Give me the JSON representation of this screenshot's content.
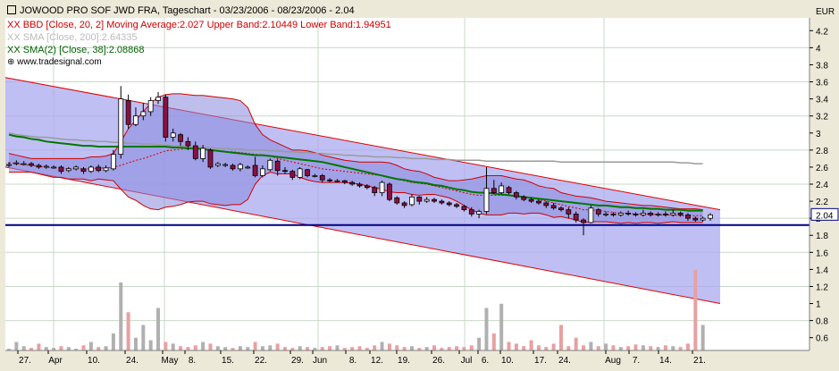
{
  "chart_data": {
    "type": "candlestick",
    "title": "JOWOOD PRO SOF JWD FRA, Tageschart - 03/23/2006 - 08/23/2006 - 2.04",
    "legend": [
      {
        "text": "XX BBD [Close, 20, 2] Moving Average:2.027 Upper Band:2.10449 Lower Band:1.94951",
        "color": "#cc0000"
      },
      {
        "text": "XX SMA [Close, 200]:2.64335",
        "color": "#bbbbbb"
      },
      {
        "text": "XX SMA(2) [Close, 38]:2.08868",
        "color": "#006400"
      }
    ],
    "watermark": "www.tradesignal.com",
    "y_axis_unit": "EUR",
    "y_ticks": [
      "4.2",
      "4",
      "3.8",
      "3.6",
      "3.4",
      "3.2",
      "3",
      "2.8",
      "2.6",
      "2.4",
      "2.2",
      "2",
      "1.8",
      "1.6",
      "1.4",
      "1.2",
      "1",
      "0.8",
      "0.6"
    ],
    "last_price_label": "2.04",
    "y_range": [
      0.45,
      4.35
    ],
    "x_labels": [
      "27.",
      "Apr",
      "10.",
      "24.",
      "May",
      "8.",
      "15.",
      "22.",
      "29.",
      "Jun",
      "8.",
      "12.",
      "19.",
      "26.",
      "Jul",
      "6.",
      "10.",
      "17.",
      "24.",
      "Aug",
      "7.",
      "14.",
      "21."
    ],
    "horizontal_line": 1.92,
    "channel": {
      "upper": [
        3.65,
        2.1
      ],
      "lower": [
        2.6,
        1.0
      ]
    },
    "candles": [
      [
        2.62,
        2.63,
        2.66,
        2.6
      ],
      [
        2.64,
        2.65,
        2.68,
        2.62
      ],
      [
        2.64,
        2.64,
        2.67,
        2.62
      ],
      [
        2.64,
        2.62,
        2.66,
        2.6
      ],
      [
        2.62,
        2.6,
        2.64,
        2.58
      ],
      [
        2.6,
        2.61,
        2.63,
        2.58
      ],
      [
        2.6,
        2.6,
        2.62,
        2.58
      ],
      [
        2.6,
        2.55,
        2.62,
        2.52
      ],
      [
        2.56,
        2.58,
        2.6,
        2.54
      ],
      [
        2.58,
        2.6,
        2.62,
        2.56
      ],
      [
        2.58,
        2.55,
        2.6,
        2.52
      ],
      [
        2.55,
        2.6,
        2.62,
        2.53
      ],
      [
        2.6,
        2.56,
        2.63,
        2.54
      ],
      [
        2.56,
        2.59,
        2.62,
        2.54
      ],
      [
        2.58,
        2.75,
        2.8,
        2.56
      ],
      [
        2.75,
        3.4,
        3.55,
        2.7
      ],
      [
        3.38,
        3.1,
        3.45,
        3.05
      ],
      [
        3.1,
        3.2,
        3.3,
        3.08
      ],
      [
        3.2,
        3.25,
        3.35,
        3.15
      ],
      [
        3.25,
        3.38,
        3.42,
        3.2
      ],
      [
        3.38,
        3.42,
        3.48,
        3.34
      ],
      [
        3.42,
        2.95,
        3.45,
        2.9
      ],
      [
        2.95,
        3.0,
        3.05,
        2.9
      ],
      [
        2.98,
        2.9,
        3.0,
        2.85
      ],
      [
        2.9,
        2.85,
        2.95,
        2.8
      ],
      [
        2.85,
        2.7,
        2.9,
        2.68
      ],
      [
        2.7,
        2.82,
        2.86,
        2.66
      ],
      [
        2.8,
        2.6,
        2.82,
        2.58
      ],
      [
        2.62,
        2.64,
        2.66,
        2.6
      ],
      [
        2.63,
        2.63,
        2.65,
        2.6
      ],
      [
        2.62,
        2.58,
        2.64,
        2.56
      ],
      [
        2.58,
        2.63,
        2.65,
        2.55
      ],
      [
        2.6,
        2.6,
        2.62,
        2.58
      ],
      [
        2.62,
        2.5,
        2.72,
        2.48
      ],
      [
        2.5,
        2.58,
        2.62,
        2.48
      ],
      [
        2.57,
        2.68,
        2.7,
        2.55
      ],
      [
        2.67,
        2.56,
        2.69,
        2.5
      ],
      [
        2.56,
        2.55,
        2.6,
        2.52
      ],
      [
        2.55,
        2.48,
        2.57,
        2.45
      ],
      [
        2.48,
        2.58,
        2.6,
        2.46
      ],
      [
        2.57,
        2.5,
        2.58,
        2.48
      ],
      [
        2.5,
        2.5,
        2.52,
        2.48
      ],
      [
        2.5,
        2.45,
        2.52,
        2.42
      ],
      [
        2.45,
        2.44,
        2.47,
        2.42
      ],
      [
        2.44,
        2.44,
        2.46,
        2.42
      ],
      [
        2.44,
        2.42,
        2.45,
        2.4
      ],
      [
        2.42,
        2.4,
        2.44,
        2.38
      ],
      [
        2.4,
        2.38,
        2.42,
        2.36
      ],
      [
        2.38,
        2.36,
        2.4,
        2.34
      ],
      [
        2.36,
        2.3,
        2.38,
        2.26
      ],
      [
        2.3,
        2.42,
        2.44,
        2.26
      ],
      [
        2.4,
        2.22,
        2.42,
        2.2
      ],
      [
        2.24,
        2.18,
        2.26,
        2.16
      ],
      [
        2.18,
        2.15,
        2.2,
        2.12
      ],
      [
        2.16,
        2.25,
        2.28,
        2.14
      ],
      [
        2.25,
        2.2,
        2.26,
        2.16
      ],
      [
        2.2,
        2.22,
        2.25,
        2.18
      ],
      [
        2.22,
        2.2,
        2.24,
        2.18
      ],
      [
        2.2,
        2.18,
        2.22,
        2.16
      ],
      [
        2.18,
        2.16,
        2.2,
        2.14
      ],
      [
        2.16,
        2.14,
        2.18,
        2.12
      ],
      [
        2.14,
        2.1,
        2.16,
        2.08
      ],
      [
        2.1,
        2.05,
        2.13,
        2.02
      ],
      [
        2.05,
        2.08,
        2.1,
        2.0
      ],
      [
        2.08,
        2.35,
        2.6,
        2.05
      ],
      [
        2.35,
        2.3,
        2.45,
        2.28
      ],
      [
        2.3,
        2.38,
        2.42,
        2.28
      ],
      [
        2.36,
        2.3,
        2.38,
        2.28
      ],
      [
        2.3,
        2.25,
        2.32,
        2.22
      ],
      [
        2.25,
        2.22,
        2.27,
        2.2
      ],
      [
        2.22,
        2.2,
        2.24,
        2.18
      ],
      [
        2.2,
        2.18,
        2.22,
        2.16
      ],
      [
        2.18,
        2.15,
        2.2,
        2.12
      ],
      [
        2.15,
        2.12,
        2.18,
        2.1
      ],
      [
        2.12,
        2.1,
        2.14,
        2.08
      ],
      [
        2.1,
        2.05,
        2.13,
        2.0
      ],
      [
        2.05,
        1.98,
        2.08,
        1.95
      ],
      [
        1.98,
        1.95,
        2.0,
        1.8
      ],
      [
        1.95,
        2.12,
        2.15,
        1.94
      ],
      [
        2.1,
        2.05,
        2.12,
        2.02
      ],
      [
        2.05,
        2.05,
        2.08,
        2.02
      ],
      [
        2.05,
        2.04,
        2.07,
        2.02
      ],
      [
        2.04,
        2.06,
        2.08,
        2.02
      ],
      [
        2.06,
        2.05,
        2.09,
        2.03
      ],
      [
        2.05,
        2.04,
        2.07,
        2.02
      ],
      [
        2.04,
        2.06,
        2.1,
        2.02
      ],
      [
        2.06,
        2.04,
        2.08,
        2.02
      ],
      [
        2.04,
        2.05,
        2.07,
        2.02
      ],
      [
        2.05,
        2.04,
        2.08,
        2.02
      ],
      [
        2.04,
        2.06,
        2.1,
        2.02
      ],
      [
        2.06,
        2.04,
        2.08,
        2.02
      ],
      [
        2.04,
        2.0,
        2.06,
        1.97
      ],
      [
        2.0,
        1.98,
        2.02,
        1.96
      ],
      [
        1.98,
        2.0,
        2.02,
        1.96
      ],
      [
        2.0,
        2.04,
        2.06,
        1.97
      ]
    ],
    "bb_upper": [
      2.76,
      2.74,
      2.72,
      2.7,
      2.7,
      2.7,
      2.7,
      2.7,
      2.7,
      2.7,
      2.7,
      2.72,
      2.72,
      2.73,
      2.76,
      2.9,
      3.05,
      3.15,
      3.25,
      3.35,
      3.42,
      3.45,
      3.46,
      3.46,
      3.45,
      3.44,
      3.44,
      3.43,
      3.42,
      3.41,
      3.4,
      3.38,
      3.3,
      3.1,
      2.98,
      2.92,
      2.88,
      2.84,
      2.8,
      2.8,
      2.79,
      2.77,
      2.74,
      2.72,
      2.7,
      2.68,
      2.67,
      2.66,
      2.66,
      2.66,
      2.66,
      2.65,
      2.62,
      2.58,
      2.56,
      2.55,
      2.52,
      2.48,
      2.46,
      2.44,
      2.44,
      2.45,
      2.46,
      2.48,
      2.5,
      2.5,
      2.5,
      2.48,
      2.46,
      2.45,
      2.42,
      2.38,
      2.36,
      2.35,
      2.3,
      2.28,
      2.26,
      2.25,
      2.24,
      2.22,
      2.2,
      2.19,
      2.18,
      2.17,
      2.16,
      2.15,
      2.15,
      2.14,
      2.13,
      2.12,
      2.11,
      2.11,
      2.11,
      2.1
    ],
    "bb_middle": [
      2.65,
      2.64,
      2.63,
      2.62,
      2.61,
      2.6,
      2.59,
      2.59,
      2.58,
      2.58,
      2.58,
      2.58,
      2.59,
      2.59,
      2.6,
      2.62,
      2.65,
      2.68,
      2.7,
      2.73,
      2.76,
      2.79,
      2.8,
      2.81,
      2.82,
      2.82,
      2.82,
      2.8,
      2.79,
      2.78,
      2.78,
      2.77,
      2.76,
      2.75,
      2.74,
      2.73,
      2.7,
      2.68,
      2.66,
      2.64,
      2.62,
      2.6,
      2.58,
      2.57,
      2.56,
      2.55,
      2.54,
      2.53,
      2.52,
      2.51,
      2.5,
      2.48,
      2.46,
      2.44,
      2.42,
      2.41,
      2.4,
      2.38,
      2.36,
      2.34,
      2.32,
      2.3,
      2.28,
      2.27,
      2.27,
      2.27,
      2.27,
      2.27,
      2.26,
      2.25,
      2.24,
      2.22,
      2.2,
      2.18,
      2.16,
      2.14,
      2.12,
      2.1,
      2.1,
      2.09,
      2.08,
      2.07,
      2.06,
      2.06,
      2.05,
      2.05,
      2.05,
      2.04,
      2.04,
      2.04,
      2.03,
      2.03,
      2.03,
      2.03
    ],
    "bb_lower": [
      2.54,
      2.54,
      2.54,
      2.54,
      2.52,
      2.5,
      2.48,
      2.48,
      2.46,
      2.46,
      2.46,
      2.44,
      2.46,
      2.45,
      2.44,
      2.34,
      2.25,
      2.21,
      2.15,
      2.11,
      2.1,
      2.13,
      2.14,
      2.16,
      2.19,
      2.2,
      2.2,
      2.17,
      2.16,
      2.15,
      2.16,
      2.16,
      2.22,
      2.4,
      2.5,
      2.54,
      2.52,
      2.52,
      2.52,
      2.48,
      2.45,
      2.43,
      2.42,
      2.42,
      2.42,
      2.42,
      2.41,
      2.4,
      2.38,
      2.36,
      2.34,
      2.31,
      2.3,
      2.3,
      2.28,
      2.27,
      2.28,
      2.28,
      2.26,
      2.24,
      2.2,
      2.15,
      2.1,
      2.06,
      2.04,
      2.04,
      2.04,
      2.06,
      2.06,
      2.05,
      2.06,
      2.06,
      2.04,
      2.01,
      2.02,
      2.0,
      1.98,
      1.95,
      1.96,
      1.96,
      1.96,
      1.95,
      1.94,
      1.95,
      1.94,
      1.95,
      1.95,
      1.94,
      1.95,
      1.96,
      1.95,
      1.95,
      1.95,
      1.95
    ],
    "sma200": [
      3.0,
      2.98,
      2.97,
      2.96,
      2.95,
      2.95,
      2.94,
      2.93,
      2.92,
      2.92,
      2.91,
      2.91,
      2.9,
      2.9,
      2.89,
      2.89,
      2.88,
      2.88,
      2.87,
      2.87,
      2.86,
      2.86,
      2.85,
      2.85,
      2.84,
      2.84,
      2.83,
      2.83,
      2.82,
      2.82,
      2.81,
      2.81,
      2.8,
      2.8,
      2.8,
      2.79,
      2.79,
      2.78,
      2.78,
      2.77,
      2.77,
      2.76,
      2.76,
      2.75,
      2.75,
      2.74,
      2.74,
      2.73,
      2.73,
      2.72,
      2.72,
      2.72,
      2.71,
      2.71,
      2.7,
      2.7,
      2.7,
      2.69,
      2.69,
      2.69,
      2.68,
      2.68,
      2.68,
      2.68,
      2.67,
      2.67,
      2.67,
      2.67,
      2.67,
      2.67,
      2.67,
      2.67,
      2.67,
      2.67,
      2.66,
      2.66,
      2.66,
      2.66,
      2.66,
      2.66,
      2.66,
      2.66,
      2.66,
      2.66,
      2.66,
      2.66,
      2.66,
      2.66,
      2.66,
      2.66,
      2.65,
      2.65,
      2.64,
      2.64
    ],
    "sma38": [
      2.98,
      2.96,
      2.95,
      2.93,
      2.92,
      2.9,
      2.89,
      2.88,
      2.87,
      2.86,
      2.85,
      2.85,
      2.84,
      2.84,
      2.84,
      2.84,
      2.84,
      2.84,
      2.84,
      2.84,
      2.84,
      2.84,
      2.83,
      2.83,
      2.82,
      2.82,
      2.81,
      2.8,
      2.79,
      2.78,
      2.77,
      2.76,
      2.75,
      2.74,
      2.74,
      2.73,
      2.72,
      2.71,
      2.7,
      2.69,
      2.68,
      2.67,
      2.66,
      2.64,
      2.62,
      2.6,
      2.58,
      2.56,
      2.54,
      2.52,
      2.5,
      2.48,
      2.46,
      2.45,
      2.43,
      2.42,
      2.41,
      2.39,
      2.38,
      2.36,
      2.34,
      2.33,
      2.31,
      2.3,
      2.3,
      2.29,
      2.28,
      2.27,
      2.26,
      2.25,
      2.24,
      2.23,
      2.22,
      2.21,
      2.2,
      2.19,
      2.18,
      2.17,
      2.16,
      2.15,
      2.15,
      2.14,
      2.13,
      2.13,
      2.12,
      2.12,
      2.11,
      2.11,
      2.1,
      2.1,
      2.1,
      2.09,
      2.09,
      2.09
    ],
    "volume": [
      0.02,
      0.1,
      0.05,
      0.03,
      0.08,
      0.04,
      0.03,
      0.05,
      0.04,
      0.02,
      0.06,
      0.1,
      0.04,
      0.05,
      0.2,
      0.8,
      0.45,
      0.15,
      0.3,
      0.12,
      0.5,
      0.1,
      0.08,
      0.05,
      0.04,
      0.06,
      0.1,
      0.08,
      0.05,
      0.04,
      0.03,
      0.05,
      0.04,
      0.1,
      0.05,
      0.06,
      0.08,
      0.04,
      0.03,
      0.05,
      0.04,
      0.03,
      0.04,
      0.05,
      0.06,
      0.03,
      0.04,
      0.05,
      0.03,
      0.06,
      0.1,
      0.08,
      0.06,
      0.04,
      0.05,
      0.03,
      0.04,
      0.06,
      0.03,
      0.04,
      0.05,
      0.04,
      0.06,
      0.15,
      0.5,
      0.2,
      0.55,
      0.1,
      0.08,
      0.05,
      0.12,
      0.06,
      0.04,
      0.08,
      0.3,
      0.05,
      0.15,
      0.06,
      0.1,
      0.05,
      0.08,
      0.06,
      0.04,
      0.05,
      0.07,
      0.06,
      0.05,
      0.04,
      0.06,
      0.05,
      0.04,
      0.08,
      0.95,
      0.3
    ]
  }
}
